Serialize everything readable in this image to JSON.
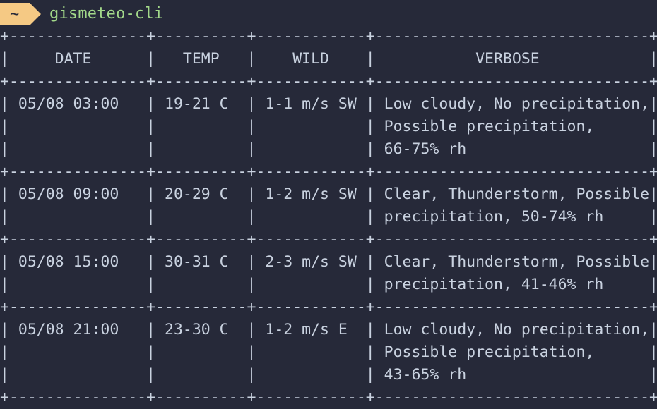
{
  "prompt": {
    "cwd": "~",
    "command": "gismeteo-cli",
    "badge_color": "#f5c984",
    "command_color": "#a3d98a"
  },
  "table": {
    "columns": [
      "DATE",
      "TEMP",
      "WILD",
      "VERBOSE"
    ],
    "rows": [
      {
        "date": "05/08 03:00",
        "temp": "19-21 C",
        "wild": "1-1 m/s SW",
        "verbose": "Low cloudy, No precipitation, Possible precipitation, 66-75% rh"
      },
      {
        "date": "05/08 09:00",
        "temp": "20-29 C",
        "wild": "1-2 m/s SW",
        "verbose": "Clear, Thunderstorm, Possible precipitation, 50-74% rh"
      },
      {
        "date": "05/08 15:00",
        "temp": "30-31 C",
        "wild": "2-3 m/s SW",
        "verbose": "Clear, Thunderstorm, Possible precipitation, 41-46% rh"
      },
      {
        "date": "05/08 21:00",
        "temp": "23-30 C",
        "wild": "1-2 m/s E",
        "verbose": "Low cloudy, No precipitation, Possible precipitation, 43-65% rh"
      }
    ]
  },
  "colors": {
    "background": "#262939",
    "text": "#c9d2e0"
  }
}
